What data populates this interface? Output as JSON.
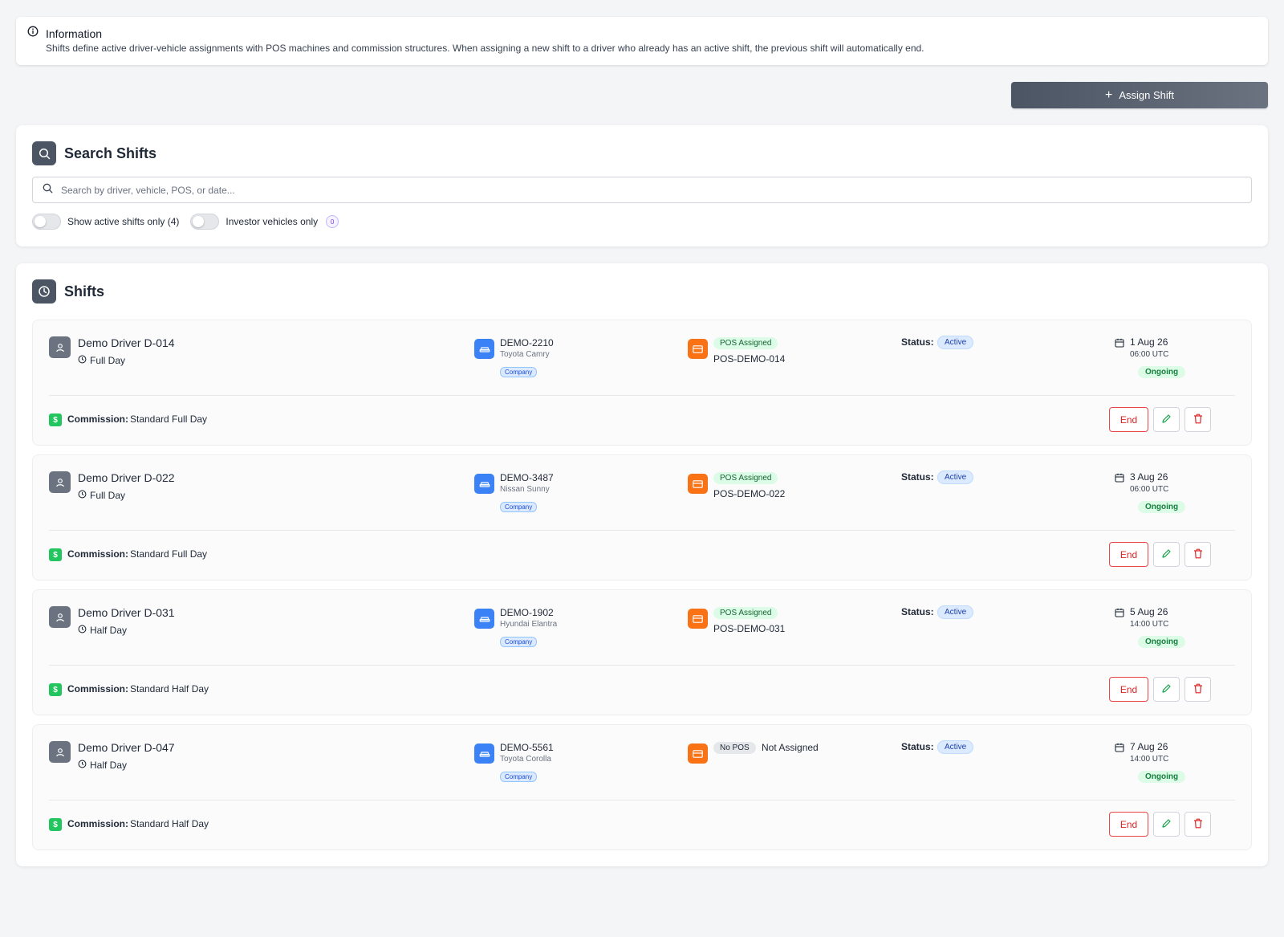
{
  "info": {
    "title": "Information",
    "text": "Shifts define active driver-vehicle assignments with POS machines and commission structures. When assigning a new shift to a driver who already has an active shift, the previous shift will automatically end."
  },
  "toolbar": {
    "assign_label": "Assign Shift"
  },
  "search": {
    "title": "Search Shifts",
    "placeholder": "Search by driver, vehicle, POS, or date...",
    "toggle_active_label": "Show active shifts only (4)",
    "toggle_investor_label": "Investor vehicles only",
    "investor_count": "0"
  },
  "shifts": {
    "title": "Shifts",
    "status_label": "Status:",
    "commission_label": "Commission:",
    "end_label": "End",
    "items": [
      {
        "driver": "Demo Driver D-014",
        "shift_type": "Full Day",
        "plate": "DEMO-2210",
        "model": "Toyota Camry",
        "owner": "Company",
        "pos_badge": "POS Assigned",
        "pos_id": "POS-DEMO-014",
        "pos_assigned": true,
        "status": "Active",
        "date": "1 Aug 26",
        "time": "06:00 UTC",
        "state": "Ongoing",
        "commission": "Standard Full Day"
      },
      {
        "driver": "Demo Driver D-022",
        "shift_type": "Full Day",
        "plate": "DEMO-3487",
        "model": "Nissan Sunny",
        "owner": "Company",
        "pos_badge": "POS Assigned",
        "pos_id": "POS-DEMO-022",
        "pos_assigned": true,
        "status": "Active",
        "date": "3 Aug 26",
        "time": "06:00 UTC",
        "state": "Ongoing",
        "commission": "Standard Full Day"
      },
      {
        "driver": "Demo Driver D-031",
        "shift_type": "Half Day",
        "plate": "DEMO-1902",
        "model": "Hyundai Elantra",
        "owner": "Company",
        "pos_badge": "POS Assigned",
        "pos_id": "POS-DEMO-031",
        "pos_assigned": true,
        "status": "Active",
        "date": "5 Aug 26",
        "time": "14:00 UTC",
        "state": "Ongoing",
        "commission": "Standard Half Day"
      },
      {
        "driver": "Demo Driver D-047",
        "shift_type": "Half Day",
        "plate": "DEMO-5561",
        "model": "Toyota Corolla",
        "owner": "Company",
        "pos_badge": "No POS",
        "pos_id": "Not Assigned",
        "pos_assigned": false,
        "status": "Active",
        "date": "7 Aug 26",
        "time": "14:00 UTC",
        "state": "Ongoing",
        "commission": "Standard Half Day"
      }
    ]
  },
  "colors": {
    "accent": "#4b5563",
    "vehicle": "#3b82f6",
    "pos": "#f97316",
    "commission": "#22c55e",
    "danger": "#dc2626",
    "success": "#15803d"
  },
  "icons": {
    "info": "info-icon",
    "search": "search-icon",
    "clock": "clock-icon",
    "user": "user-icon",
    "car": "car-icon",
    "pos": "credit-card-icon",
    "calendar": "calendar-icon",
    "dollar": "dollar-icon",
    "edit": "pencil-icon",
    "delete": "trash-icon",
    "plus": "plus-icon"
  }
}
